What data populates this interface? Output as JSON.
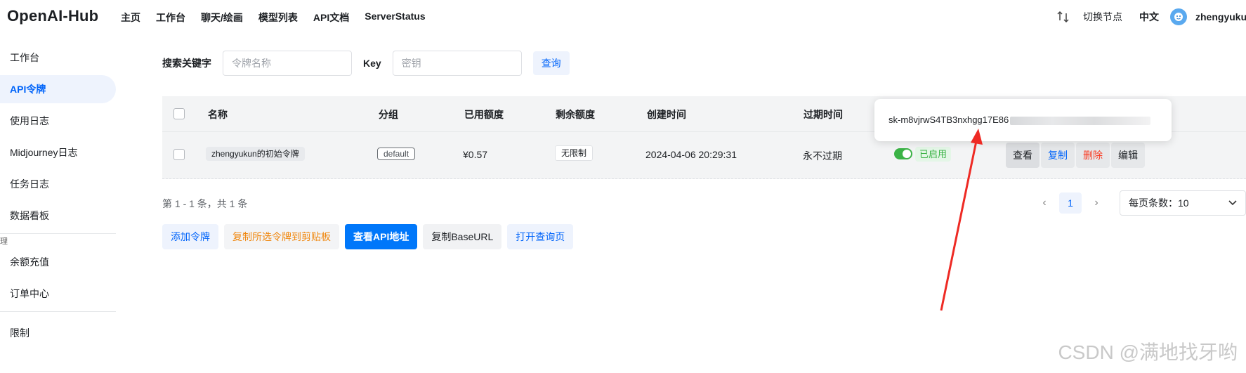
{
  "brand": "OpenAI-Hub",
  "topnav": [
    "主页",
    "工作台",
    "聊天/绘画",
    "模型列表",
    "API文档",
    "ServerStatus"
  ],
  "topright": {
    "switch_node": "切换节点",
    "lang": "中文",
    "username": "zhengyukun"
  },
  "sidebar": {
    "items": [
      "工作台",
      "API令牌",
      "使用日志",
      "Midjourney日志",
      "任务日志",
      "数据看板"
    ],
    "group_label": "理",
    "items2": [
      "余额充值",
      "订单中心"
    ],
    "items3": [
      "限制"
    ]
  },
  "search": {
    "keyword_label": "搜索关键字",
    "keyword_placeholder": "令牌名称",
    "key_label": "Key",
    "key_placeholder": "密钥",
    "query_button": "查询"
  },
  "table": {
    "headers": [
      "名称",
      "分组",
      "已用额度",
      "剩余额度",
      "创建时间",
      "过期时间"
    ],
    "rows": [
      {
        "name": "zhengyukun的初始令牌",
        "group": "default",
        "used": "¥0.57",
        "remaining": "无限制",
        "created": "2024-04-06 20:29:31",
        "expires": "永不过期",
        "status": "已启用",
        "ops": [
          "查看",
          "复制",
          "删除",
          "编辑"
        ]
      }
    ]
  },
  "popover": {
    "key_visible": "sk-m8vjrwS4TB3nxhgg17E86"
  },
  "summary": "第 1 - 1 条，共 1 条",
  "pager": {
    "current": "1",
    "page_size_label": "每页条数：10"
  },
  "actions": [
    "添加令牌",
    "复制所选令牌到剪贴板",
    "查看API地址",
    "复制BaseURL",
    "打开查询页"
  ],
  "watermark": "CSDN @满地找牙哟",
  "colors": {
    "primary": "#0077fa",
    "link": "#0064fa",
    "success": "#3bb346",
    "danger": "#f93920",
    "warning": "#f0870e",
    "annotation": "#ee2a24"
  }
}
